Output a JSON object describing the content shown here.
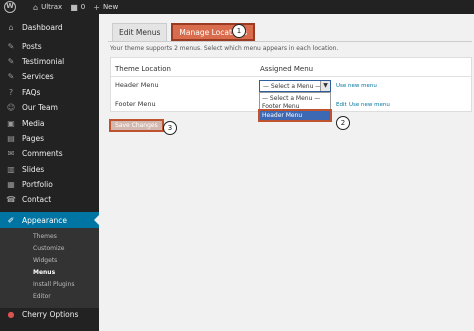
{
  "adminbar": {
    "wp_logo": "W",
    "site_name": "Ultrax",
    "comments_count": "0",
    "new_label": "New"
  },
  "sidebar": {
    "items": [
      {
        "label": "Dashboard",
        "icon": "⌂"
      },
      {
        "label": "Posts",
        "icon": "✎"
      },
      {
        "label": "Testimonial",
        "icon": "✎"
      },
      {
        "label": "Services",
        "icon": "✎"
      },
      {
        "label": "FAQs",
        "icon": "?"
      },
      {
        "label": "Our Team",
        "icon": "☺"
      },
      {
        "label": "Media",
        "icon": "▣"
      },
      {
        "label": "Pages",
        "icon": "▤"
      },
      {
        "label": "Comments",
        "icon": "✉"
      },
      {
        "label": "Slides",
        "icon": "▥"
      },
      {
        "label": "Portfolio",
        "icon": "▦"
      },
      {
        "label": "Contact",
        "icon": "☎"
      },
      {
        "label": "Appearance",
        "icon": "✐"
      }
    ],
    "submenu": [
      "Themes",
      "Customize",
      "Widgets",
      "Menus",
      "Install Plugins",
      "Editor"
    ],
    "cherry": {
      "label": "Cherry Options",
      "icon": "●"
    }
  },
  "tabs": {
    "edit_menus": "Edit Menus",
    "manage_locations": "Manage Locations"
  },
  "callouts": [
    "1",
    "2",
    "3"
  ],
  "description": "Your theme supports 2 menus. Select which menu appears in each location.",
  "table": {
    "col_location": "Theme Location",
    "col_assigned": "Assigned Menu",
    "rows": [
      "Header Menu",
      "Footer Menu"
    ]
  },
  "select": {
    "current": "— Select a Menu —",
    "options": [
      "— Select a Menu —",
      "Footer Menu",
      "Header Menu"
    ]
  },
  "links": {
    "use_new_menu": "Use new menu",
    "edit": "Edit"
  },
  "save_button": "Save Changes",
  "colors": {
    "accent": "#0074a2",
    "highlight": "#d96c4c"
  }
}
